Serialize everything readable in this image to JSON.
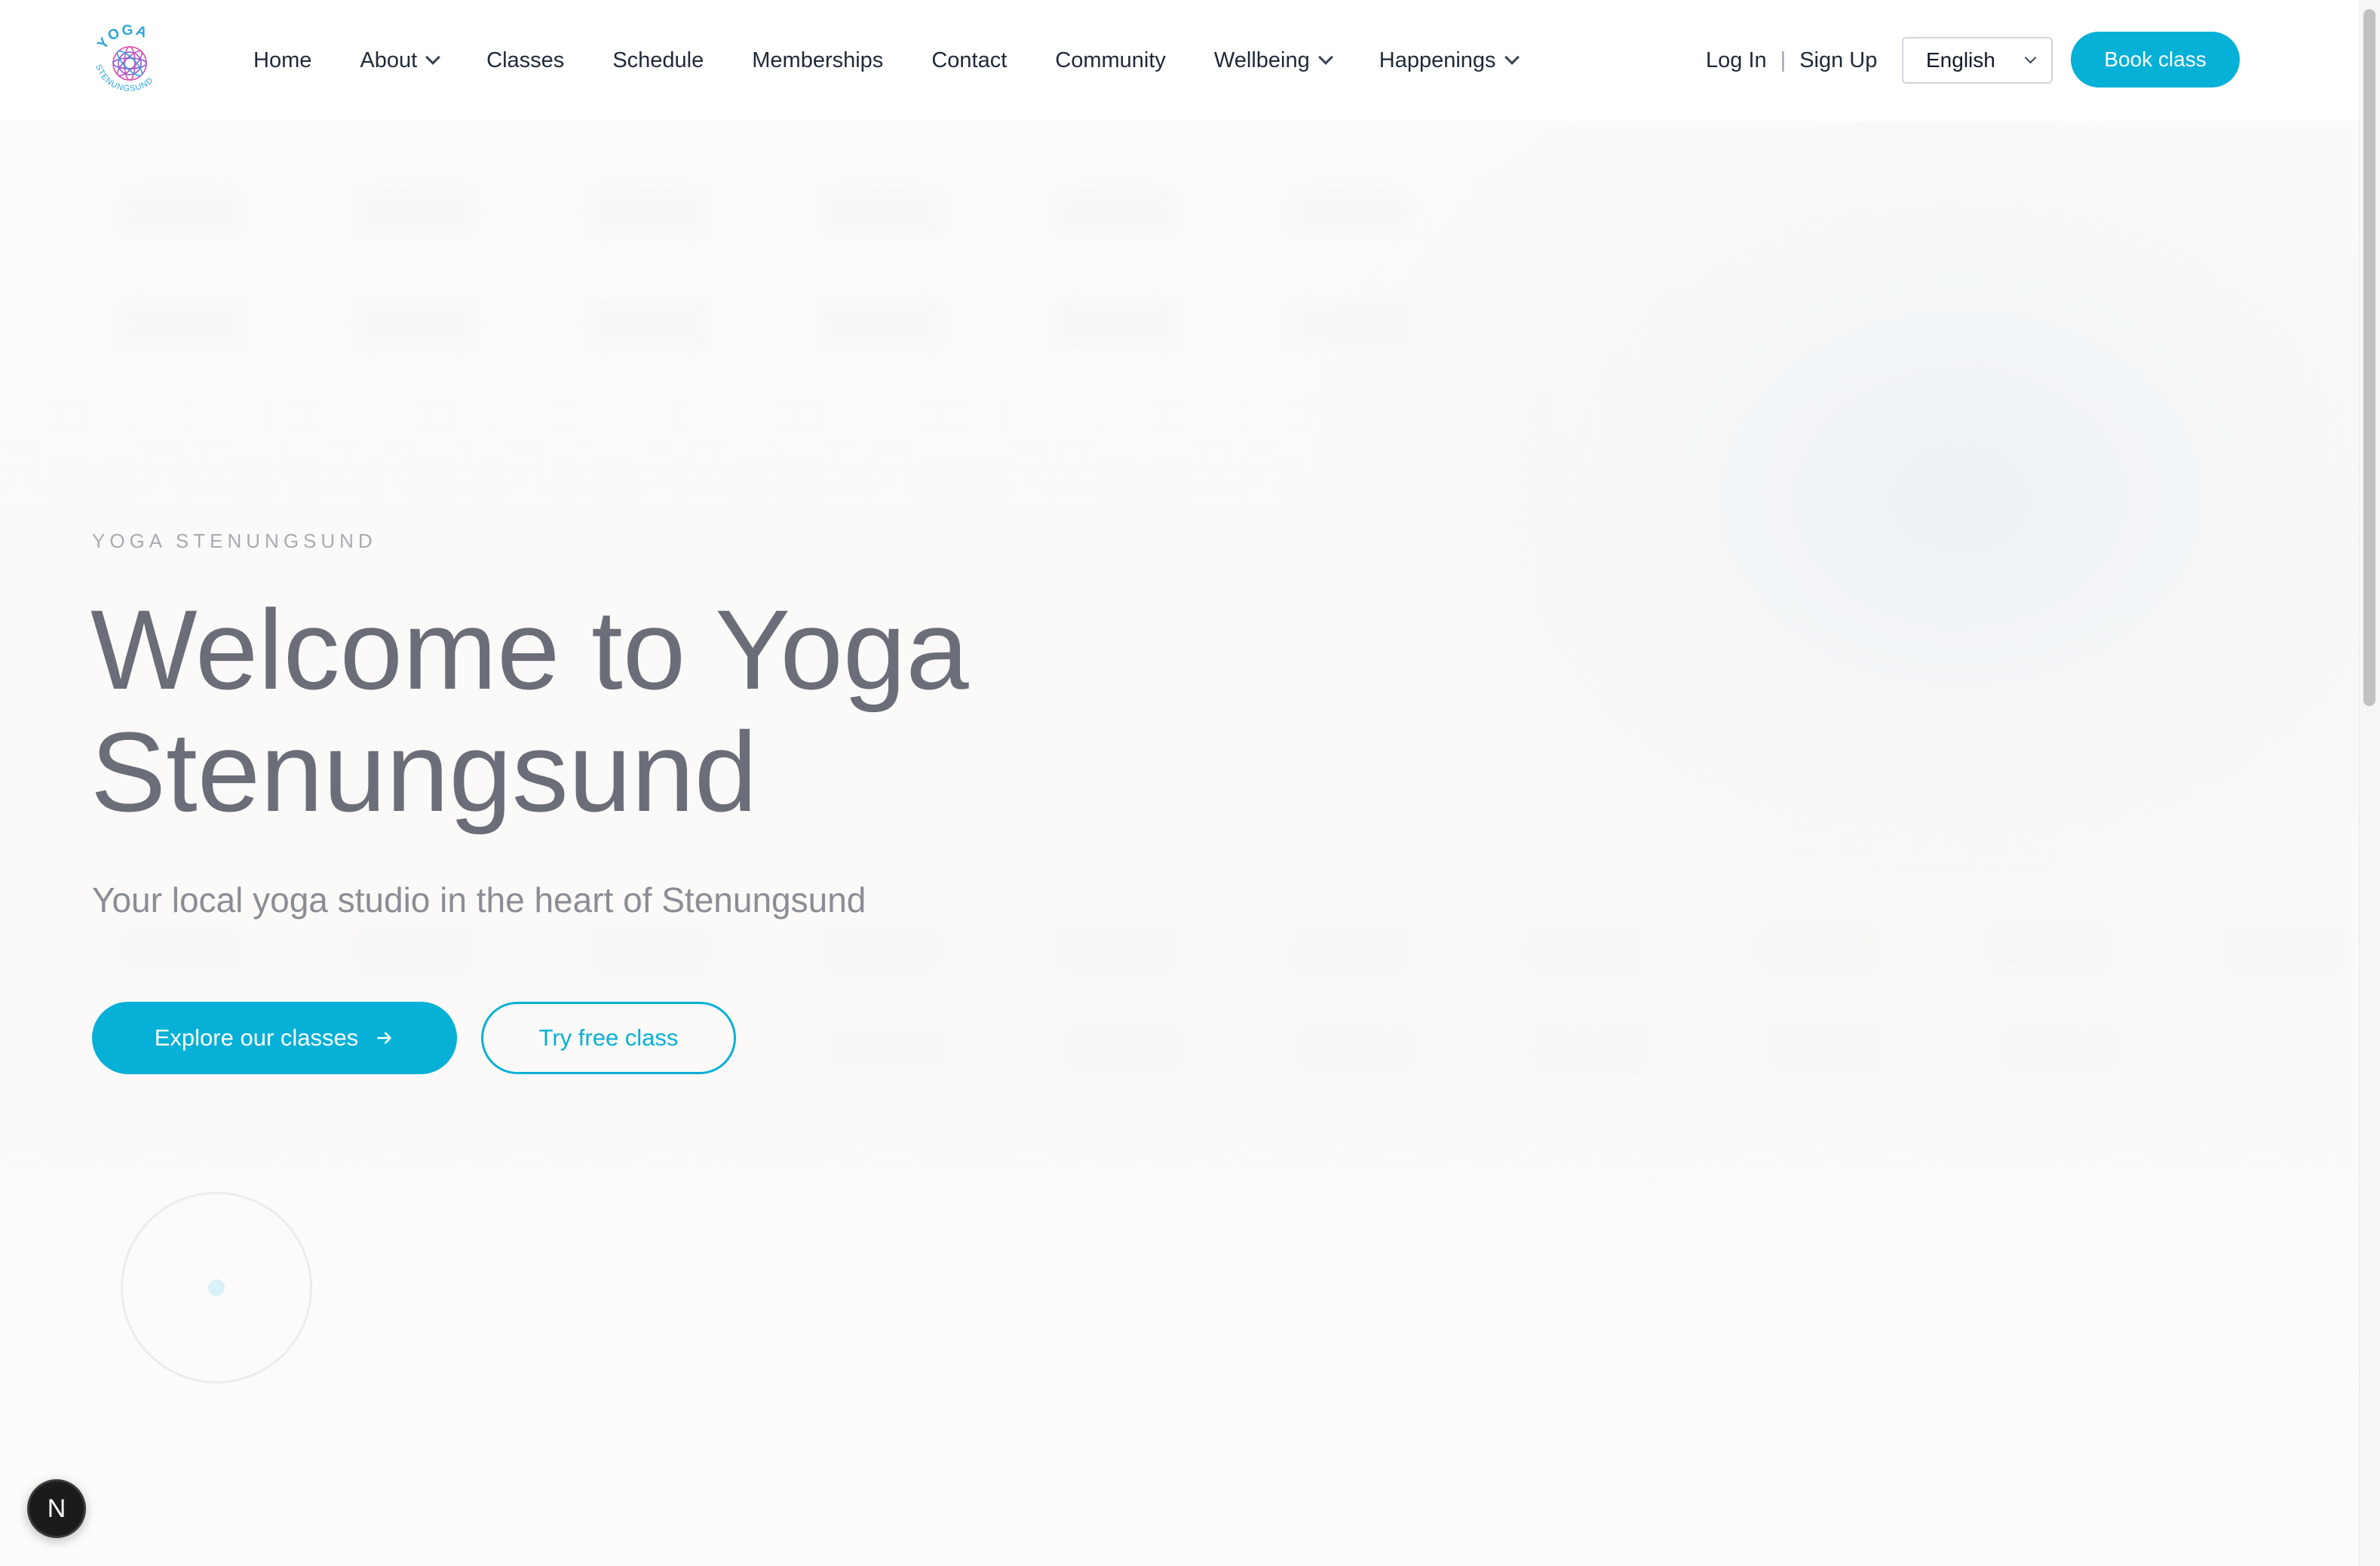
{
  "header": {
    "logo": {
      "top_text": "YOGA",
      "bottom_text": "STENUNGSUND"
    },
    "nav": [
      {
        "label": "Home",
        "has_dropdown": false
      },
      {
        "label": "About",
        "has_dropdown": true
      },
      {
        "label": "Classes",
        "has_dropdown": false
      },
      {
        "label": "Schedule",
        "has_dropdown": false
      },
      {
        "label": "Memberships",
        "has_dropdown": false
      },
      {
        "label": "Contact",
        "has_dropdown": false
      },
      {
        "label": "Community",
        "has_dropdown": false
      },
      {
        "label": "Wellbeing",
        "has_dropdown": true
      },
      {
        "label": "Happenings",
        "has_dropdown": true
      }
    ],
    "login_label": "Log In",
    "separator": "|",
    "signup_label": "Sign Up",
    "language": {
      "selected": "English"
    },
    "book_label": "Book class"
  },
  "hero": {
    "eyebrow": "YOGA STENUNGSUND",
    "title_line1": "Welcome to Yoga",
    "title_line2": "Stenungsund",
    "subtitle": "Your local yoga studio in the heart of Stenungsund",
    "primary_cta": "Explore our classes",
    "secondary_cta": "Try free class"
  },
  "dev_badge": {
    "label": "N"
  },
  "colors": {
    "accent": "#06b0d6",
    "text_dark": "#1f2937",
    "hero_title": "#6b6e78",
    "muted": "#8a8d94",
    "logo_pink": "#e04ba8",
    "logo_blue": "#2aa6d9"
  },
  "icons": {
    "arrow": "arrow-right-icon",
    "chevron": "chevron-down-icon",
    "logo": "mandala-logo-icon"
  }
}
